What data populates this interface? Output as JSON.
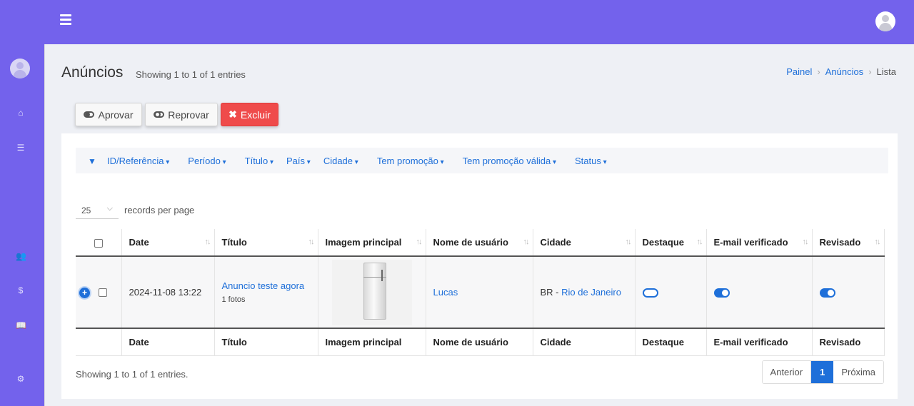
{
  "header": {
    "menu_icon": "hamburger-icon",
    "user_icon": "user-avatar-icon"
  },
  "sidebar": {
    "items": [
      {
        "icon": "home-icon"
      },
      {
        "icon": "list-icon"
      },
      {
        "icon": "users-icon"
      },
      {
        "icon": "dollar-icon"
      },
      {
        "icon": "book-icon"
      },
      {
        "icon": "gear-icon"
      }
    ]
  },
  "page": {
    "title": "Anúncios",
    "subtitle": "Showing 1 to 1 of 1 entries"
  },
  "breadcrumb": {
    "items": [
      "Painel",
      "Anúncios",
      "Lista"
    ]
  },
  "actions": {
    "approve": "Aprovar",
    "reject": "Reprovar",
    "delete": "Excluir"
  },
  "filters": {
    "items": [
      "ID/Referência",
      "Período",
      "Título",
      "País",
      "Cidade",
      "Tem promoção",
      "Tem promoção válida",
      "Status"
    ]
  },
  "length": {
    "value": "25",
    "label": "records per page"
  },
  "table": {
    "columns": [
      "Date",
      "Título",
      "Imagem principal",
      "Nome de usuário",
      "Cidade",
      "Destaque",
      "E-mail verificado",
      "Revisado"
    ],
    "rows": [
      {
        "date": "2024-11-08 13:22",
        "title": "Anuncio teste agora",
        "photos": "1 fotos",
        "image": "refrigerator-photo",
        "username": "Lucas",
        "city_prefix": "BR - ",
        "city": "Rio de Janeiro",
        "featured": false,
        "email_verified": true,
        "reviewed": true
      }
    ]
  },
  "footer": {
    "info": "Showing 1 to 1 of 1 entries.",
    "prev": "Anterior",
    "page": "1",
    "next": "Próxima"
  },
  "colors": {
    "brand": "#7362ec",
    "link": "#1e6fd9",
    "danger": "#ef4b4b"
  }
}
